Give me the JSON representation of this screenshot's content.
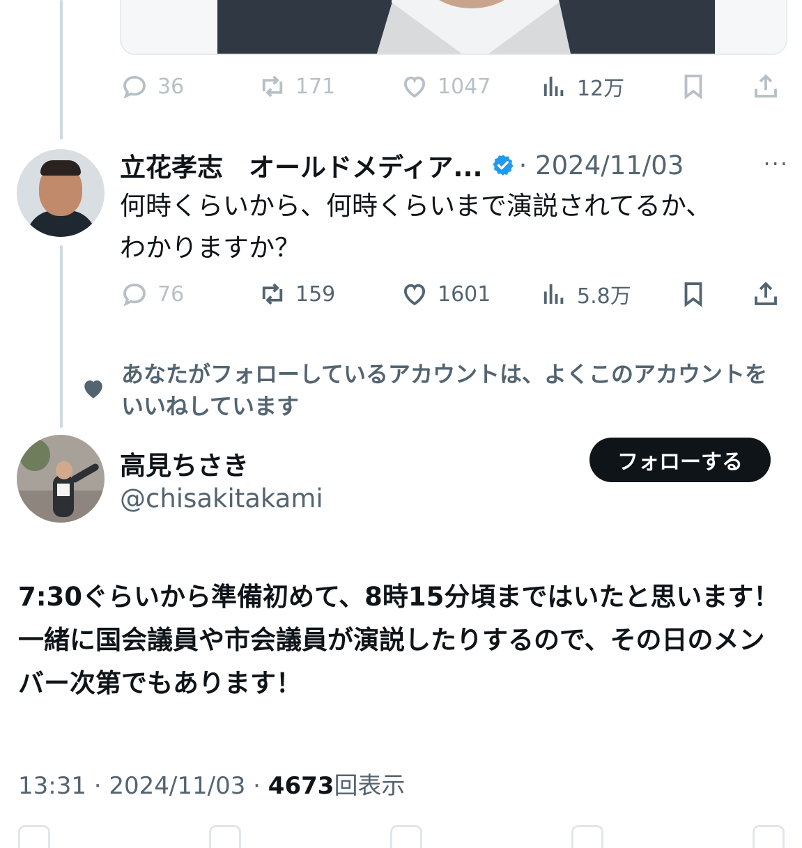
{
  "tweet_prev": {
    "actions": {
      "replies": "36",
      "retweets": "171",
      "likes": "1047",
      "views": "12万"
    }
  },
  "tweet_reply": {
    "author_name": "立花孝志　オールドメディア...",
    "meta": "· 2024/11/03",
    "more": "···",
    "text_line1": "何時くらいから、何時くらいまで演説されてるか、",
    "text_line2": "わかりますか？",
    "actions": {
      "replies": "76",
      "retweets": "159",
      "likes": "1601",
      "views": "5.8万"
    }
  },
  "social_context": {
    "text": "あなたがフォローしているアカウントは、よくこのアカウントをいいねしています"
  },
  "main_tweet": {
    "author_name": "高見ちさき",
    "handle": "@chisakitakami",
    "follow_label": "フォローする",
    "text": "7:30ぐらいから準備初めて、8時15分頃まではいたと思います！一緒に国会議員や市会議員が演説したりするので、その日のメンバー次第でもあります！",
    "time_prefix": "13:31 · 2024/11/03 · ",
    "view_count": "4673",
    "view_suffix": "回表示"
  },
  "colors": {
    "text_primary": "#0f1419",
    "text_secondary": "#536471",
    "verified_blue": "#1d9bf0",
    "thread_line": "#cfd9de",
    "button_bg": "#0f1419"
  }
}
